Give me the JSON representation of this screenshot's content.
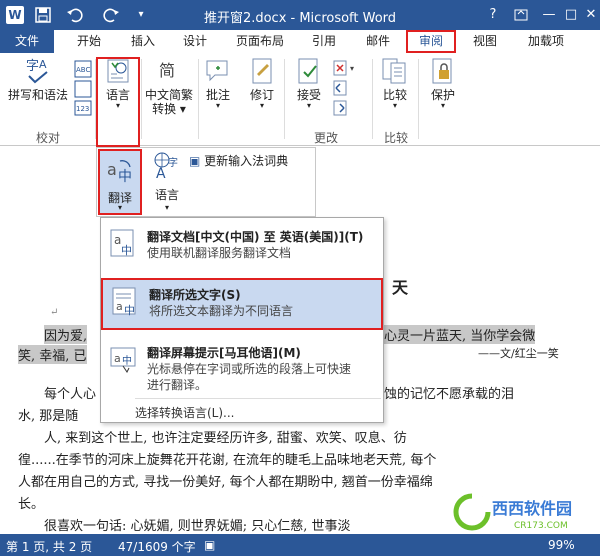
{
  "titlebar": {
    "app_icon_label": "W",
    "title": "推开窗2.docx - Microsoft Word",
    "help": "?",
    "minimize": "—",
    "maximize": "□",
    "close": "✕",
    "accent_color": "#2b5797"
  },
  "tabs": [
    {
      "label": "文件"
    },
    {
      "label": "开始"
    },
    {
      "label": "插入"
    },
    {
      "label": "设计"
    },
    {
      "label": "页面布局"
    },
    {
      "label": "引用"
    },
    {
      "label": "邮件"
    },
    {
      "label": "审阅"
    },
    {
      "label": "视图"
    },
    {
      "label": "加载项"
    }
  ],
  "ribbon": {
    "spelling": "拼写和语法",
    "language": "语言",
    "chinese_conversion_1": "中文简繁",
    "chinese_conversion_2": "转换",
    "comments": "批注",
    "track": "修订",
    "accept": "接受",
    "compare": "比较",
    "protect": "保护",
    "group_proofing": "校对",
    "group_changes": "更改",
    "group_compare": "比较",
    "abc_label": "ABC",
    "num_label": "123"
  },
  "subribbon": {
    "translate": "翻译",
    "language": "语言",
    "update_ime": "更新输入法词典"
  },
  "menu": {
    "items": [
      {
        "title": "翻译文档[中文(中国) 至 英语(美国)](T)",
        "desc1": "使用联机翻译服务翻译文档",
        "desc2": ""
      },
      {
        "title": "翻译所选文字(S)",
        "desc1": "将所选文本翻译为不同语言",
        "desc2": ""
      },
      {
        "title": "翻译屏幕提示[马耳他语](M)",
        "desc1": "光标悬停在字词或所选的段落上可快速",
        "desc2": "进行翻译。"
      }
    ],
    "choose_language": "选择转换语言(L)..."
  },
  "document": {
    "title_fragment": "天",
    "line1_left": "因为爱,",
    "line1_right": "心灵一片蓝天, 当你学会微",
    "line2_left": "笑, 幸福, 已",
    "line2_right": "——文/红尘一笑",
    "line3_left": "每个人心",
    "line3_right": "蚀的记忆不愿承载的泪",
    "line4": "水, 那是随",
    "line5": "人, 来到这个世上, 也许注定要经历许多, 甜蜜、欢笑、叹息、彷",
    "line6": "徨......在季节的河床上旋舞花开花谢, 在流年的睫毛上品味地老天荒, 每个",
    "line7": "人都在用自己的方式, 寻找一份美好, 每个人都在期盼中, 翘首一份幸福绵",
    "line8": "长。",
    "line9": "很喜欢一句话: 心妩媚, 则世界妩媚; 只心仁慈, 世事淡",
    "para_mark": "↵"
  },
  "statusbar": {
    "page": "第 1 页, 共 2 页",
    "words": "47/1609 个字",
    "zoom": "99%"
  },
  "watermark": {
    "brand": "西西软件园",
    "url": "CR173.COM"
  },
  "colors": {
    "highlight_red": "#e02020",
    "selected_bg": "#c9d9f0",
    "statusbar_bg": "#2b5797"
  }
}
